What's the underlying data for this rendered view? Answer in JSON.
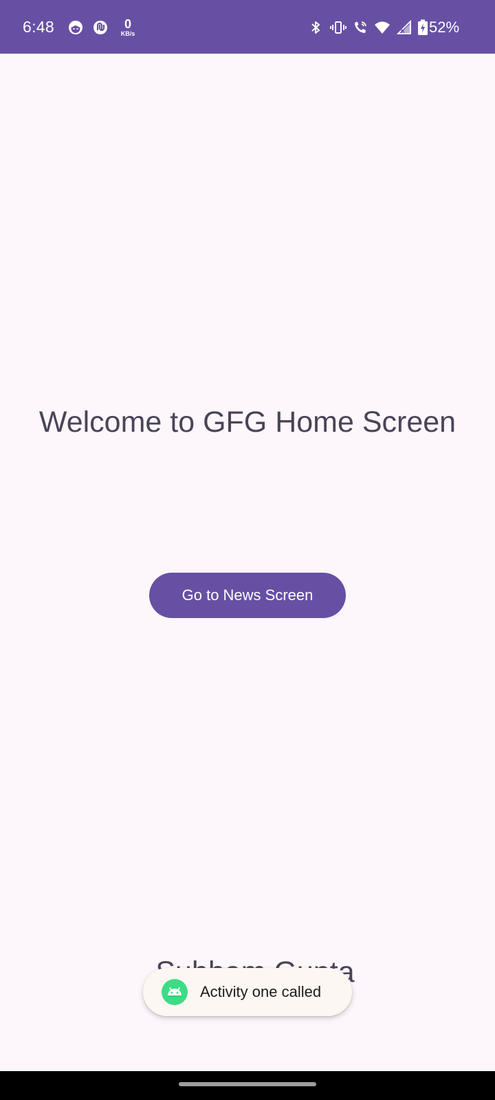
{
  "status_bar": {
    "time": "6:48",
    "data_speed_value": "0",
    "data_speed_unit": "KB/s",
    "battery_percent": "52%",
    "background_color": "#6750a4",
    "icons": [
      "app-notification-icon",
      "data-saver-icon",
      "bluetooth-icon",
      "vibrate-icon",
      "wifi-calling-icon",
      "wifi-icon",
      "cellular-signal-icon",
      "battery-charging-icon"
    ]
  },
  "main": {
    "welcome_text": "Welcome to GFG Home Screen",
    "news_button_label": "Go to News Screen",
    "author_name_partial": "Subham Gupta",
    "button_color": "#6750a4",
    "background_color": "#fdf7fc"
  },
  "toast": {
    "message": "Activity one called",
    "icon": "android-icon"
  }
}
